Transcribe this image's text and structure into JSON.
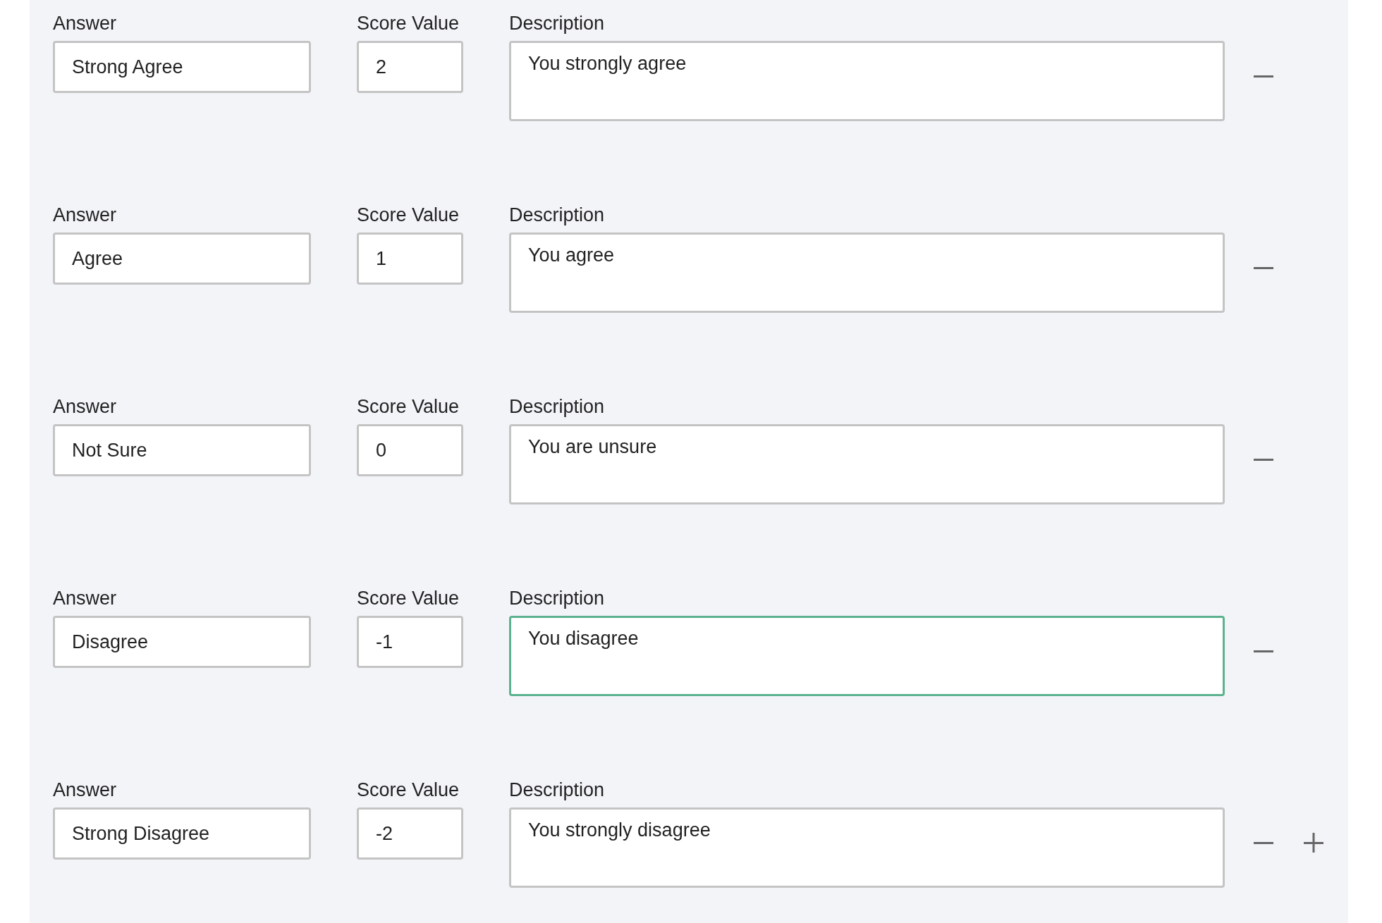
{
  "rows": [
    {
      "answer_label": "Answer",
      "answer": "Strong Agree",
      "score_label": "Score Value",
      "score": "2",
      "description_label": "Description",
      "description": "You strongly agree",
      "description_focused": false,
      "add_button": false
    },
    {
      "answer_label": "Answer",
      "answer": "Agree",
      "score_label": "Score Value",
      "score": "1",
      "description_label": "Description",
      "description": "You agree",
      "description_focused": false,
      "add_button": false
    },
    {
      "answer_label": "Answer",
      "answer": "Not Sure",
      "score_label": "Score Value",
      "score": "0",
      "description_label": "Description",
      "description": "You are unsure",
      "description_focused": false,
      "add_button": false
    },
    {
      "answer_label": "Answer",
      "answer": "Disagree",
      "score_label": "Score Value",
      "score": "-1",
      "description_label": "Description",
      "description": "You disagree",
      "description_focused": true,
      "add_button": false
    },
    {
      "answer_label": "Answer",
      "answer": "Strong Disagree",
      "score_label": "Score Value",
      "score": "-2",
      "description_label": "Description",
      "description": "You strongly disagree",
      "description_focused": false,
      "add_button": true
    }
  ]
}
